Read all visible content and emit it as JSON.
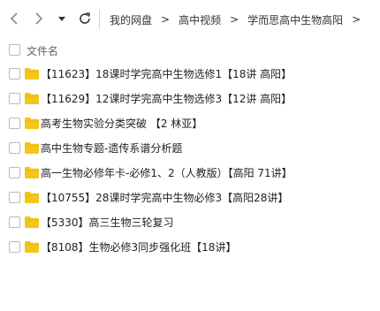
{
  "nav": {
    "back_icon": "chevron-left-icon",
    "forward_icon": "chevron-right-icon",
    "dropdown_icon": "caret-down-icon",
    "refresh_icon": "refresh-icon"
  },
  "breadcrumbs": [
    "我的网盘",
    "高中视频",
    "学而思高中生物高阳"
  ],
  "breadcrumb_separator": ">",
  "header": {
    "column_label": "文件名"
  },
  "folder_color": "#f5c518",
  "files": [
    {
      "name": "【11623】18课时学完高中生物选修1【18讲 高阳】"
    },
    {
      "name": "【11629】12课时学完高中生物选修3【12讲 高阳】"
    },
    {
      "name": "高考生物实验分类突破 【2 林亚】"
    },
    {
      "name": "高中生物专题-遗传系谱分析题"
    },
    {
      "name": "高一生物必修年卡-必修1、2（人教版）【高阳 71讲】"
    },
    {
      "name": "【10755】28课时学完高中生物必修3【高阳28讲】"
    },
    {
      "name": "【5330】高三生物三轮复习"
    },
    {
      "name": "【8108】生物必修3同步强化班【18讲】"
    }
  ]
}
